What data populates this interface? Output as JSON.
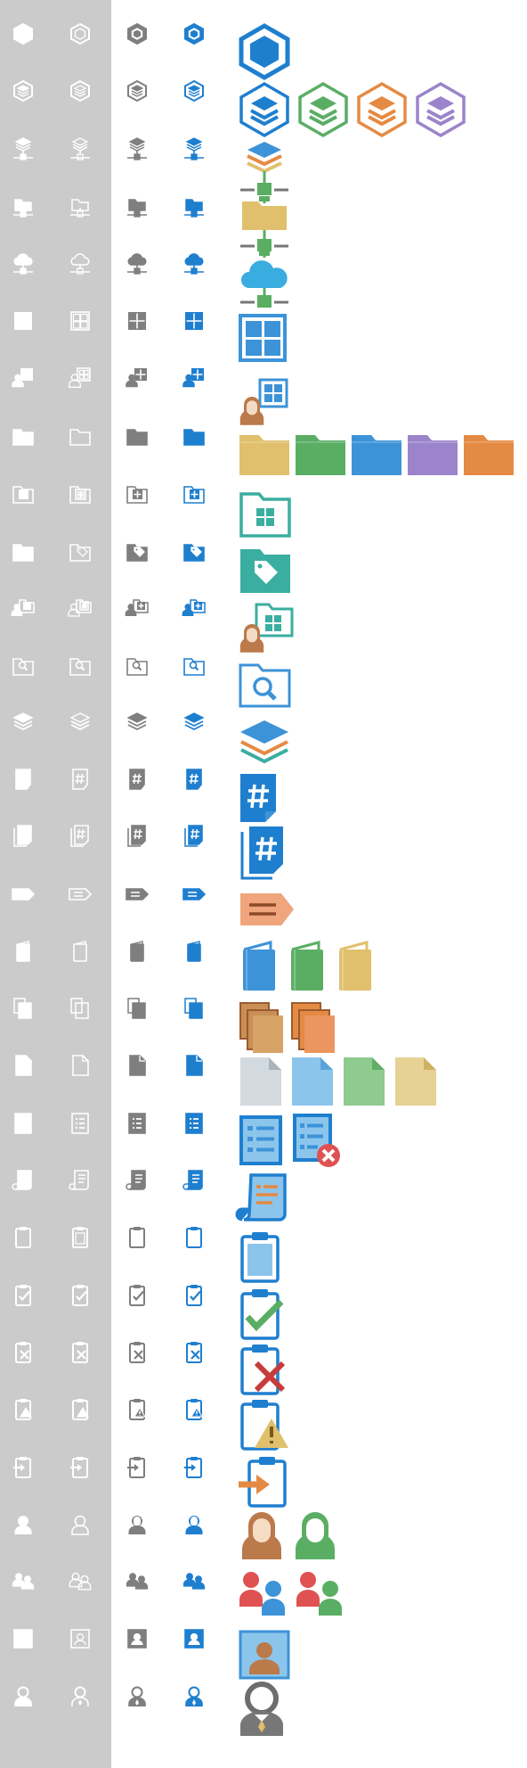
{
  "palette": {
    "white": "#ffffff",
    "gray": "#7f7f7f",
    "blue": "#1f7fcf",
    "panel": "#cbcbcb",
    "skin": "#bb7a4a",
    "green": "#5aae64",
    "orange": "#e58a43",
    "purple": "#9b84cb",
    "sand": "#e0c06d",
    "sky": "#39ace0",
    "teal": "#3aaea0",
    "softBlue": "#3d93d8",
    "red": "#e05151",
    "bluePale": "#8cc5ec",
    "greenPale": "#8fca8f",
    "sandPale": "#e6d294",
    "grayPale": "#d2d9df"
  },
  "rows": [
    {
      "name": "hexagon",
      "shape": "hex"
    },
    {
      "name": "layered-hexagon",
      "shape": "hexstack"
    },
    {
      "name": "layers-network",
      "shape": "layersnet"
    },
    {
      "name": "folder-network",
      "shape": "foldernet"
    },
    {
      "name": "cloud-network",
      "shape": "cloudnet"
    },
    {
      "name": "grid-window",
      "shape": "grid"
    },
    {
      "name": "user-grid",
      "shape": "usergrid"
    },
    {
      "name": "folder",
      "shape": "folder"
    },
    {
      "name": "folder-grid",
      "shape": "foldergrid"
    },
    {
      "name": "folder-tag",
      "shape": "foldertag"
    },
    {
      "name": "user-folder-grid",
      "shape": "userfoldergrid"
    },
    {
      "name": "folder-search",
      "shape": "foldersearch"
    },
    {
      "name": "layers",
      "shape": "layers"
    },
    {
      "name": "hash-document",
      "shape": "hashdoc"
    },
    {
      "name": "hash-documents",
      "shape": "hashdocs"
    },
    {
      "name": "tag-label",
      "shape": "taglabel"
    },
    {
      "name": "book",
      "shape": "book"
    },
    {
      "name": "books",
      "shape": "books"
    },
    {
      "name": "document",
      "shape": "doc"
    },
    {
      "name": "list-document",
      "shape": "listdoc"
    },
    {
      "name": "scroll-list",
      "shape": "scroll"
    },
    {
      "name": "clipboard",
      "shape": "clip"
    },
    {
      "name": "clipboard-check",
      "shape": "clipcheck"
    },
    {
      "name": "clipboard-cross",
      "shape": "clipx"
    },
    {
      "name": "clipboard-warning",
      "shape": "clipwarn"
    },
    {
      "name": "clipboard-import",
      "shape": "clipin"
    },
    {
      "name": "user",
      "shape": "user"
    },
    {
      "name": "users",
      "shape": "users"
    },
    {
      "name": "user-card",
      "shape": "usercard"
    },
    {
      "name": "user-tie",
      "shape": "usertie"
    }
  ],
  "variants": [
    {
      "name": "white-filled",
      "color": "white",
      "style": "filled"
    },
    {
      "name": "white-outline",
      "color": "white",
      "style": "outline"
    },
    {
      "name": "gray",
      "color": "gray",
      "style": "filled"
    },
    {
      "name": "blue",
      "color": "blue",
      "style": "filled"
    }
  ],
  "colored": [
    {
      "row": 0,
      "icon": "hex-color"
    },
    {
      "row": 1,
      "icon": "hexstack-blue"
    },
    {
      "row": 1,
      "icon": "hexstack-green"
    },
    {
      "row": 1,
      "icon": "hexstack-orange"
    },
    {
      "row": 1,
      "icon": "hexstack-purple"
    },
    {
      "row": 2,
      "icon": "layersnet-color"
    },
    {
      "row": 3,
      "icon": "foldernet-color"
    },
    {
      "row": 4,
      "icon": "cloudnet-color"
    },
    {
      "row": 5,
      "icon": "grid-color"
    },
    {
      "row": 6,
      "icon": "usergrid-color"
    },
    {
      "row": 7,
      "icon": "folder-sand"
    },
    {
      "row": 7,
      "icon": "folder-green"
    },
    {
      "row": 7,
      "icon": "folder-blue"
    },
    {
      "row": 7,
      "icon": "folder-purple"
    },
    {
      "row": 7,
      "icon": "folder-orange"
    },
    {
      "row": 8,
      "icon": "foldergrid-color"
    },
    {
      "row": 9,
      "icon": "foldertag-color"
    },
    {
      "row": 10,
      "icon": "userfoldergrid-color"
    },
    {
      "row": 11,
      "icon": "foldersearch-color"
    },
    {
      "row": 12,
      "icon": "layers-color"
    },
    {
      "row": 13,
      "icon": "hashdoc-color"
    },
    {
      "row": 14,
      "icon": "hashdocs-color"
    },
    {
      "row": 15,
      "icon": "taglabel-color"
    },
    {
      "row": 16,
      "icon": "book-blue"
    },
    {
      "row": 16,
      "icon": "book-green"
    },
    {
      "row": 16,
      "icon": "book-sand"
    },
    {
      "row": 17,
      "icon": "books-sand"
    },
    {
      "row": 17,
      "icon": "books-orange"
    },
    {
      "row": 18,
      "icon": "doc-gray"
    },
    {
      "row": 18,
      "icon": "doc-blue"
    },
    {
      "row": 18,
      "icon": "doc-green"
    },
    {
      "row": 18,
      "icon": "doc-sand"
    },
    {
      "row": 19,
      "icon": "listdoc-color"
    },
    {
      "row": 19,
      "icon": "listdoc-error"
    },
    {
      "row": 20,
      "icon": "scroll-color"
    },
    {
      "row": 21,
      "icon": "clip-color"
    },
    {
      "row": 22,
      "icon": "clipcheck-color"
    },
    {
      "row": 23,
      "icon": "clipx-color"
    },
    {
      "row": 24,
      "icon": "clipwarn-color"
    },
    {
      "row": 25,
      "icon": "clipin-color"
    },
    {
      "row": 26,
      "icon": "user-orange"
    },
    {
      "row": 26,
      "icon": "user-green"
    },
    {
      "row": 27,
      "icon": "users-red-blue"
    },
    {
      "row": 27,
      "icon": "users-red-green"
    },
    {
      "row": 28,
      "icon": "usercard-color"
    },
    {
      "row": 29,
      "icon": "usertie-color"
    }
  ]
}
